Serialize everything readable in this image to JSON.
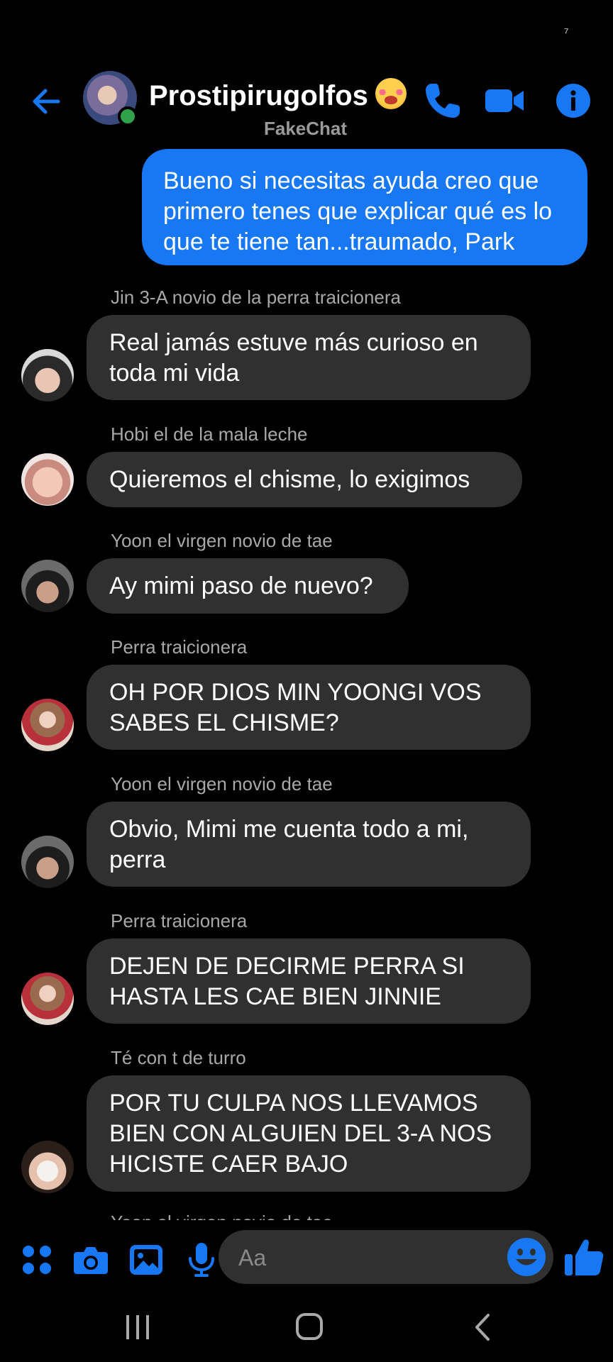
{
  "status_bar": {
    "mark": "⁷"
  },
  "header": {
    "chat_name": "Prostipirugolfos",
    "subtitle": "FakeChat",
    "accent_color": "#1877f2",
    "online_color": "#31a24c"
  },
  "sent_message": {
    "text": "Bueno si necesitas ayuda creo que primero tenes que explicar qué es lo que te tiene tan...traumado, Park"
  },
  "messages": [
    {
      "sender": "Jin 3-A novio de la perra traicionera",
      "text": "Real jamás estuve más curioso en toda mi vida"
    },
    {
      "sender": "Hobi el de la mala leche",
      "text": "Quieremos el chisme, lo exigimos"
    },
    {
      "sender": "Yoon el virgen novio de tae",
      "text": "Ay mimi paso de nuevo?"
    },
    {
      "sender": "Perra traicionera",
      "text": "OH POR DIOS MIN YOONGI VOS SABES EL CHISME?"
    },
    {
      "sender": "Yoon el virgen novio de tae",
      "text": "Obvio, Mimi me cuenta todo a mi, perra"
    },
    {
      "sender": "Perra traicionera",
      "text": "DEJEN DE DECIRME PERRA SI HASTA LES CAE BIEN JINNIE"
    },
    {
      "sender": "Té con t de turro",
      "text": "POR TU CULPA NOS LLEVAMOS BIEN CON ALGUIEN DEL 3-A NOS HICISTE CAER BAJO"
    }
  ],
  "partial_sender": "Yoon el virgen novio de tae",
  "composer": {
    "placeholder": "Aa",
    "icons": [
      "apps-icon",
      "camera-icon",
      "gallery-icon",
      "microphone-icon",
      "emoji-icon",
      "thumbs-up-icon"
    ]
  },
  "system_nav": {
    "icons": [
      "recents-icon",
      "home-icon",
      "back-icon"
    ]
  }
}
